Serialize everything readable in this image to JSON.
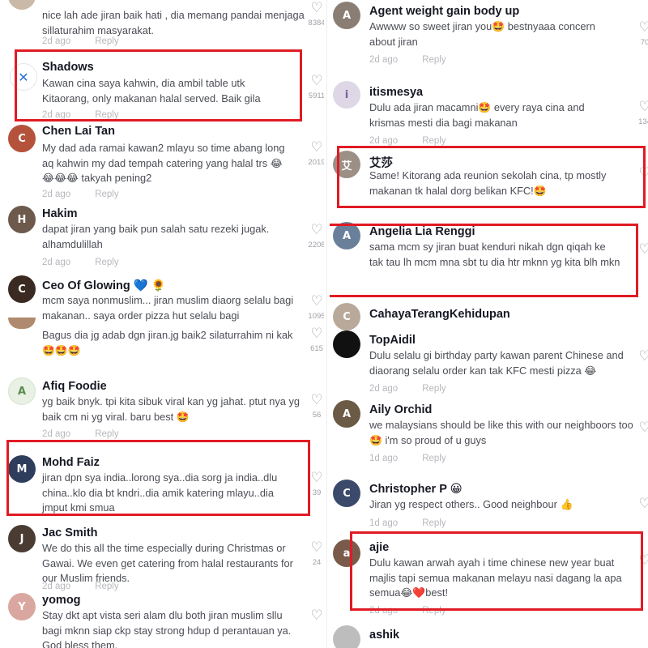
{
  "left": [
    {
      "name": "",
      "text": "nice lah ade jiran baik hati , dia memang pandai menjaga sillaturahim masyarakat.",
      "time": "2d ago",
      "reply": "Reply",
      "likes": "8384",
      "avatar_color": "#c9b9a6",
      "initial": ""
    },
    {
      "name": "Shadows",
      "text": "Kawan cina saya kahwin, dia ambil table utk Kitaorang, only makanan halal served. Baik gila",
      "time": "2d ago",
      "reply": "Reply",
      "likes": "5911",
      "avatar_color": "#ffffff",
      "initial": "✕"
    },
    {
      "name": "Chen Lai Tan",
      "text": "My dad ada ramai kawan2 mlayu so time abang long aq kahwin my dad tempah catering yang halal trs 😂 😂😂😂 takyah pening2",
      "time": "2d ago",
      "reply": "Reply",
      "likes": "2019",
      "avatar_color": "#b5523b",
      "initial": "C"
    },
    {
      "name": "Hakim",
      "text": "dapat jiran yang baik pun salah satu rezeki jugak. alhamdulillah",
      "time": "2d ago",
      "reply": "Reply",
      "likes": "2208",
      "avatar_color": "#6d5a4d",
      "initial": "H"
    },
    {
      "name": "Ceo Of Glowing 💙 🌻",
      "text": "mcm saya nonmuslim... jiran muslim diaorg selalu bagi makanan.. saya order pizza hut selalu bagi",
      "time": "",
      "reply": "",
      "likes": "1095",
      "avatar_color": "#3a2a22",
      "initial": "C"
    },
    {
      "name": "",
      "text": "Bagus dia jg adab dgn jiran.jg baik2 silaturrahim ni kak 🤩🤩🤩",
      "time": "",
      "reply": "",
      "likes": "615",
      "avatar_color": "",
      "initial": ""
    },
    {
      "name": "Afiq Foodie",
      "text": "yg baik bnyk. tpi kita sibuk viral kan yg jahat. ptut nya yg baik cm ni yg viral. baru best 🤩",
      "time": "2d ago",
      "reply": "Reply",
      "likes": "56",
      "avatar_color": "#e8f1e4",
      "initial": "A"
    },
    {
      "name": "Mohd Faiz",
      "text": "jiran dpn sya india..lorong sya..dia sorg ja india..dlu china..klo dia bt kndri..dia amik katering mlayu..dia jmput kmi smua",
      "time": "",
      "reply": "",
      "likes": "39",
      "avatar_color": "#2f3d5c",
      "initial": "M"
    },
    {
      "name": "Jac Smith",
      "text": "We do this all the time especially during Christmas or Gawai. We even get catering from halal restaurants for our Muslim friends.",
      "time": "2d ago",
      "reply": "Reply",
      "likes": "24",
      "avatar_color": "#4a3b33",
      "initial": "J"
    },
    {
      "name": "yomog",
      "text": "Stay dkt apt vista seri alam dlu both jiran muslim sllu bagi mknn siap ckp stay strong hdup d perantauan ya. God bless them.",
      "time": "",
      "reply": "",
      "likes": "",
      "avatar_color": "#d9a7a0",
      "initial": "Y"
    }
  ],
  "right": [
    {
      "name": "Agent weight gain body up",
      "text": "Awwww so sweet jiran you🤩 bestnyaaa concern about jiran",
      "time": "2d ago",
      "reply": "Reply",
      "likes": "70",
      "avatar_color": "#8a7d74",
      "initial": "A"
    },
    {
      "name": "itismesya",
      "text": "Dulu ada jiran macamni🤩 every raya cina and krismas mesti dia bagi makanan",
      "time": "2d ago",
      "reply": "Reply",
      "likes": "134",
      "avatar_color": "#ded7e6",
      "initial": "i"
    },
    {
      "name": "艾莎",
      "text": "Same! Kitorang ada reunion sekolah cina, tp mostly makanan tk halal dorg belikan KFC!🤩",
      "time": "",
      "reply": "",
      "likes": "",
      "avatar_color": "#9c8f86",
      "initial": "艾"
    },
    {
      "name": "Angelia Lia Renggi",
      "text": "sama mcm sy jiran buat kenduri nikah dgn qiqah ke tak tau lh mcm mna sbt tu dia htr mknn yg kita blh mkn",
      "time": "",
      "reply": "",
      "likes": "",
      "avatar_color": "#6a7f9a",
      "initial": "A"
    },
    {
      "name": "CahayaTerangKehidupan",
      "text": "",
      "time": "",
      "reply": "",
      "likes": "",
      "avatar_color": "#b8a99a",
      "initial": "C"
    },
    {
      "name": "TopAidil",
      "text": "Dulu selalu gi birthday party kawan parent Chinese and diaorang selalu order kan tak KFC mesti pizza 😂",
      "time": "2d ago",
      "reply": "Reply",
      "likes": "",
      "avatar_color": "#111111",
      "initial": ""
    },
    {
      "name": "Aily Orchid",
      "text": "we malaysians should be like this with our neighboors too🤩 i'm so proud of u guys",
      "time": "1d ago",
      "reply": "Reply",
      "likes": "",
      "avatar_color": "#6b5a45",
      "initial": "A"
    },
    {
      "name": "Christopher P 😀",
      "text": "Jiran yg respect others.. Good neighbour 👍",
      "time": "1d ago",
      "reply": "Reply",
      "likes": "",
      "avatar_color": "#3b4a6a",
      "initial": "C"
    },
    {
      "name": "ajie",
      "text": "Dulu kawan arwah ayah i time chinese new year buat majlis tapi semua makanan melayu nasi dagang la apa semua😂❤️best!",
      "time": "2d ago",
      "reply": "Reply",
      "likes": "",
      "avatar_color": "#7a5b4b",
      "initial": "a"
    },
    {
      "name": "ashik",
      "text": "",
      "time": "",
      "reply": "",
      "likes": "",
      "avatar_color": "#bdbdbd",
      "initial": ""
    }
  ]
}
